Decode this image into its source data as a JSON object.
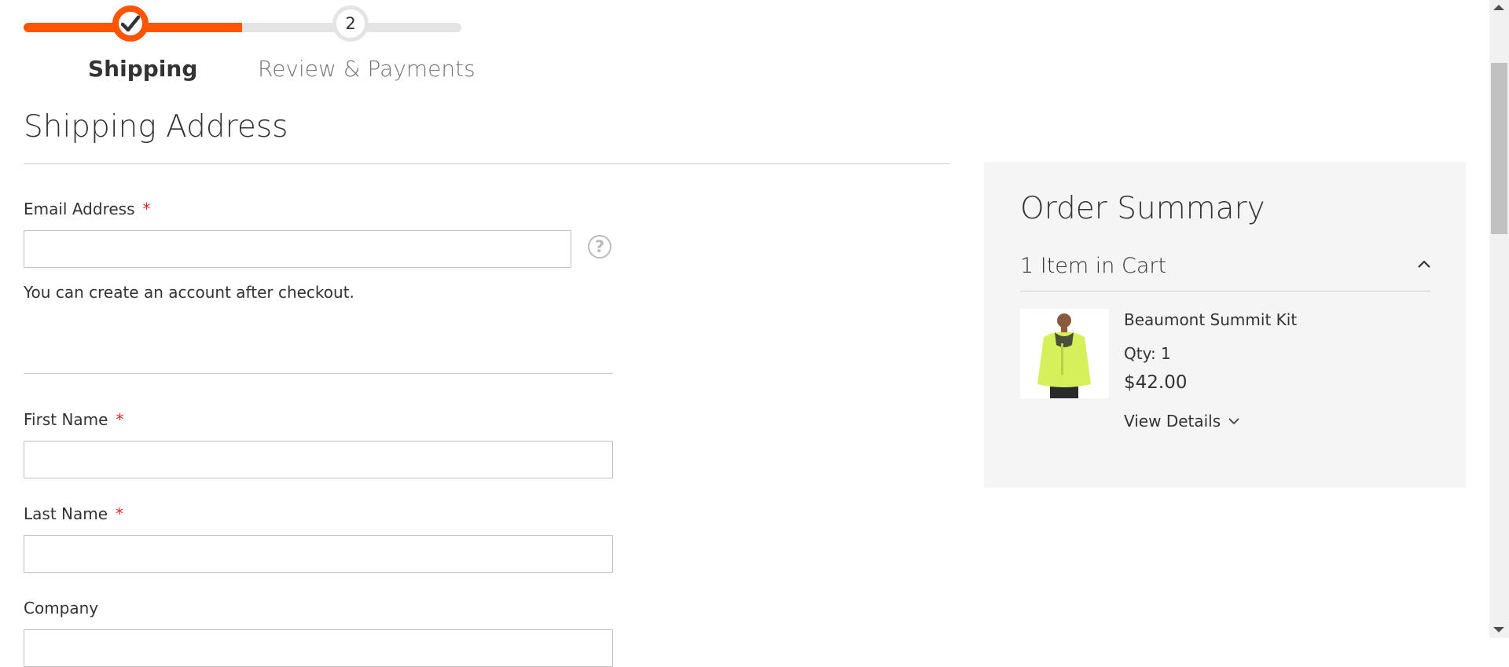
{
  "progress": {
    "steps": [
      {
        "label": "Shipping",
        "state": "complete"
      },
      {
        "label": "Review & Payments",
        "number": "2",
        "state": "pending"
      }
    ],
    "accent_color": "#ff5501"
  },
  "shipping": {
    "title": "Shipping Address",
    "email_label": "Email Address",
    "required_mark": "*",
    "email_value": "",
    "help_icon": "?",
    "email_note": "You can create an account after checkout.",
    "first_name_label": "First Name",
    "first_name_value": "",
    "last_name_label": "Last Name",
    "last_name_value": "",
    "company_label": "Company",
    "company_value": ""
  },
  "summary": {
    "title": "Order Summary",
    "cart_count": "1 Item in Cart",
    "item": {
      "name": "Beaumont Summit Kit",
      "qty": "Qty: 1",
      "price": "$42.00",
      "view_details": "View Details"
    }
  }
}
